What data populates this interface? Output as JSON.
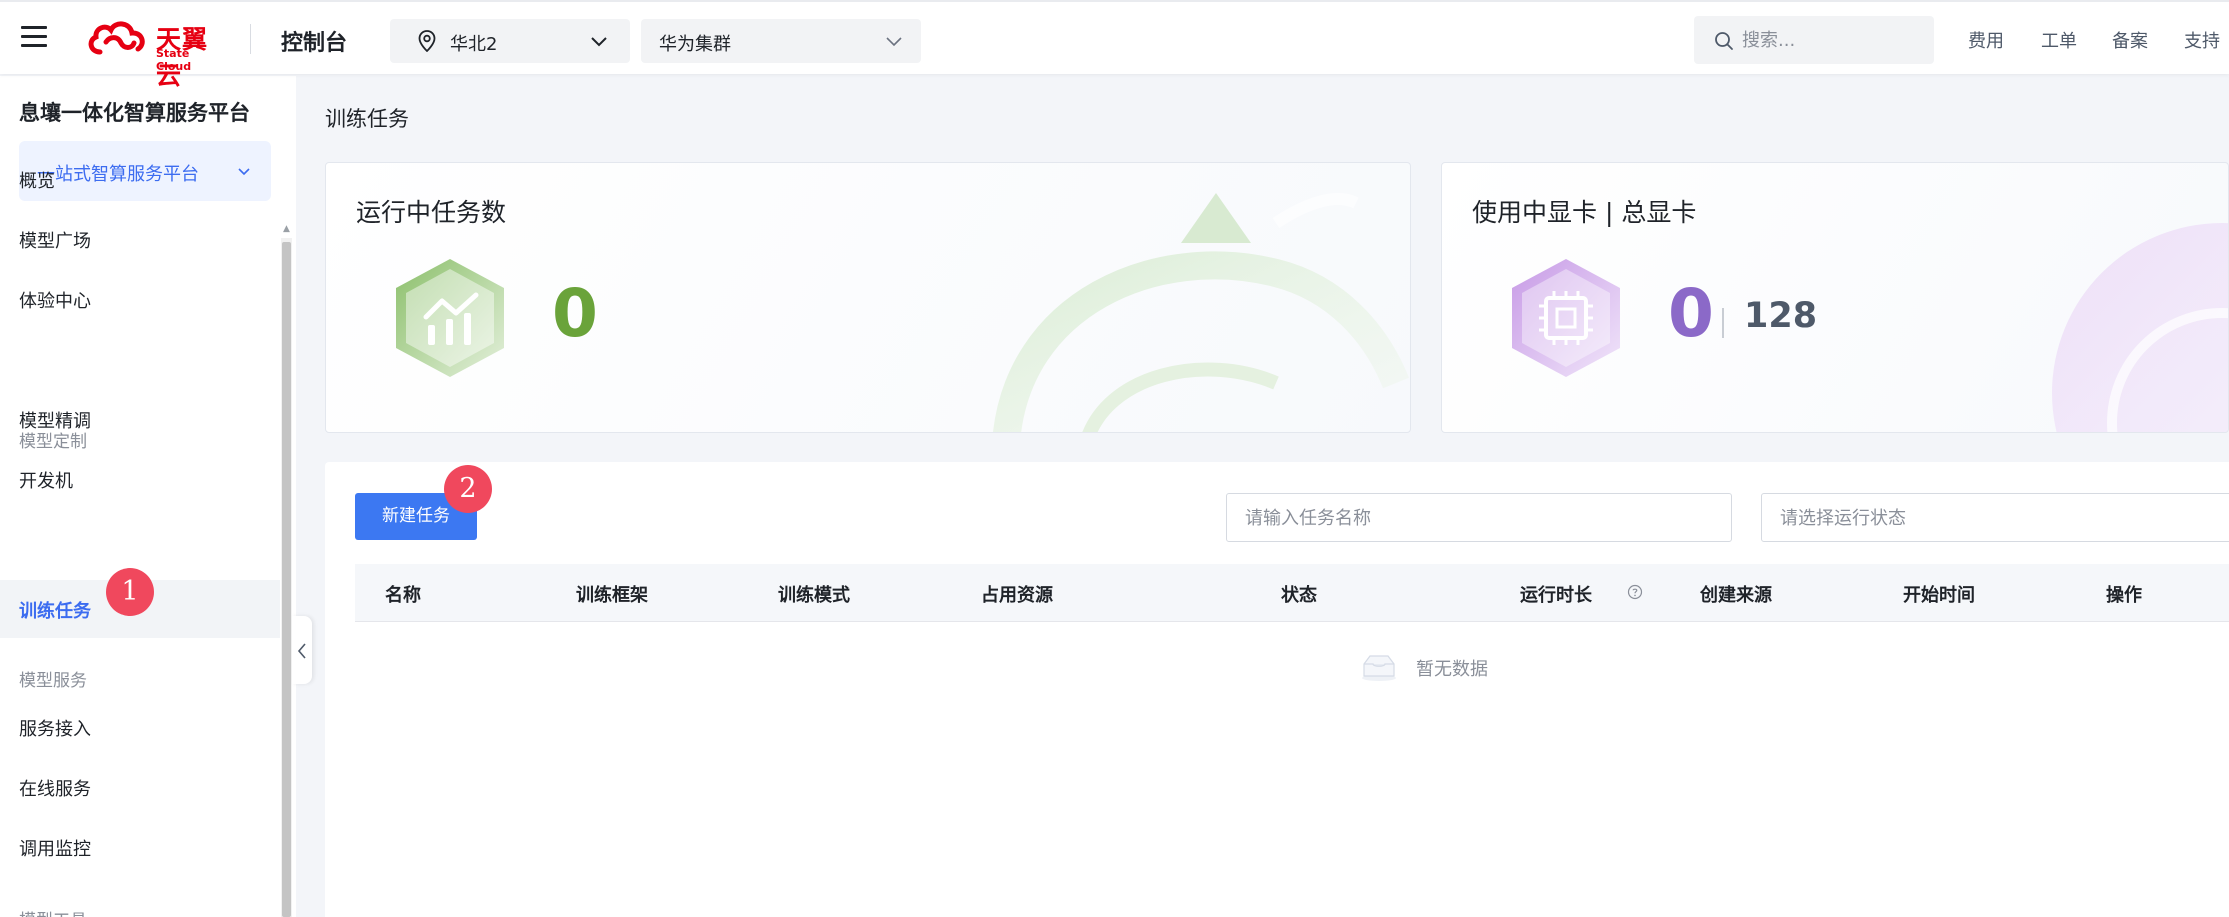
{
  "header": {
    "logo_cn": "天翼云",
    "logo_en": "State Cloud",
    "console_title": "控制台",
    "region": "华北2",
    "cluster": "华为集群",
    "search_placeholder": "搜索...",
    "links": [
      "费用",
      "工单",
      "备案",
      "支持"
    ]
  },
  "sidebar": {
    "platform_title": "息壤一体化智算服务平台",
    "platform_select": "一站式智算服务平台",
    "items": [
      {
        "label": "概览"
      },
      {
        "label": "模型广场"
      },
      {
        "label": "体验中心"
      },
      {
        "group": "模型定制"
      },
      {
        "label": "模型精调"
      },
      {
        "label": "开发机"
      },
      {
        "label": "训练任务"
      },
      {
        "group": "模型服务"
      },
      {
        "label": "服务接入"
      },
      {
        "label": "在线服务"
      },
      {
        "label": "调用监控"
      },
      {
        "group": "模型工具"
      }
    ]
  },
  "main": {
    "breadcrumb": "训练任务",
    "cards": {
      "running": {
        "title": "运行中任务数",
        "value": "0",
        "color": "#6aa33a"
      },
      "gpu": {
        "title": "使用中显卡 | 总显卡",
        "used": "0",
        "total": "128",
        "color": "#8b69c8"
      }
    },
    "toolbar": {
      "new_task": "新建任务",
      "name_placeholder": "请输入任务名称",
      "status_placeholder": "请选择运行状态"
    },
    "table": {
      "columns": [
        "名称",
        "训练框架",
        "训练模式",
        "占用资源",
        "状态",
        "运行时长",
        "创建来源",
        "开始时间",
        "操作"
      ],
      "empty_text": "暂无数据"
    }
  },
  "markers": [
    "1",
    "2"
  ],
  "colors": {
    "accent": "#3c6cf0",
    "button": "#3c78f2",
    "marker": "#f0485d",
    "brand_red": "#e60012"
  }
}
